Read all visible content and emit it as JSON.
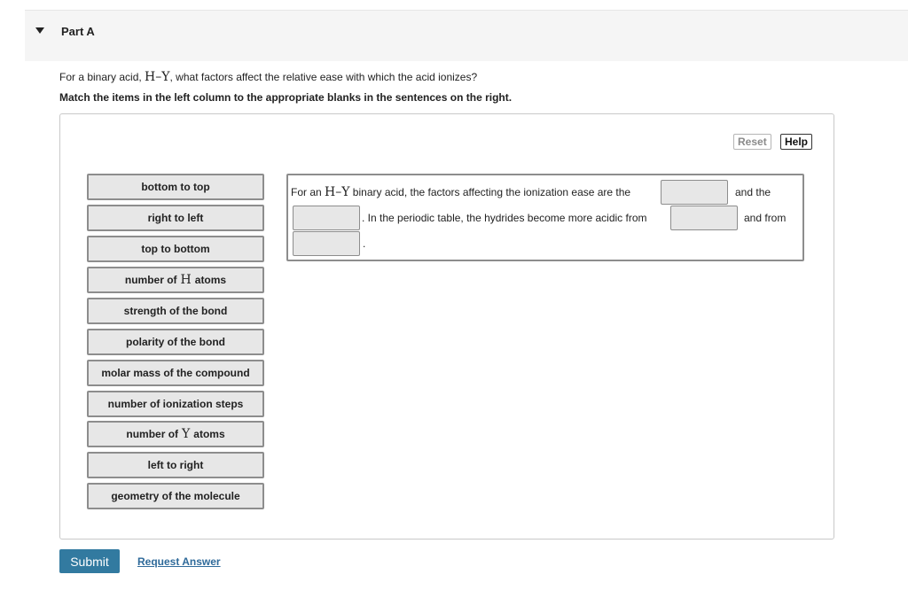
{
  "part": {
    "title": "Part A"
  },
  "question": {
    "prefix": "For a binary acid, ",
    "formula_h": "H",
    "formula_dash": "–",
    "formula_y": "Y",
    "suffix": ", what factors affect the relative ease with which the acid ionizes?"
  },
  "instructions": "Match the items in the left column to the appropriate blanks in the sentences on the right.",
  "toolbar": {
    "reset_label": "Reset",
    "help_label": "Help"
  },
  "tiles": [
    {
      "label": "bottom to top"
    },
    {
      "label": "right to left"
    },
    {
      "label": "top to bottom"
    },
    {
      "pre": "number of",
      "sym": "H",
      "post": "atoms"
    },
    {
      "label": "strength of the bond"
    },
    {
      "label": "polarity of the bond"
    },
    {
      "label": "molar mass of the compound"
    },
    {
      "label": "number of ionization steps"
    },
    {
      "pre": "number of",
      "sym": "Y",
      "post": "atoms"
    },
    {
      "label": "left to right"
    },
    {
      "label": "geometry of the molecule"
    }
  ],
  "sentence": {
    "part1_pre": "For an ",
    "formula": "H–Y",
    "part1_post": " binary acid, the factors affecting the ionization ease are the",
    "and_the": "and the",
    "part2": ". In the periodic table, the hydrides become more acidic from",
    "and_from": "and from",
    "end": "."
  },
  "actions": {
    "submit_label": "Submit",
    "request_answer_label": "Request Answer"
  }
}
